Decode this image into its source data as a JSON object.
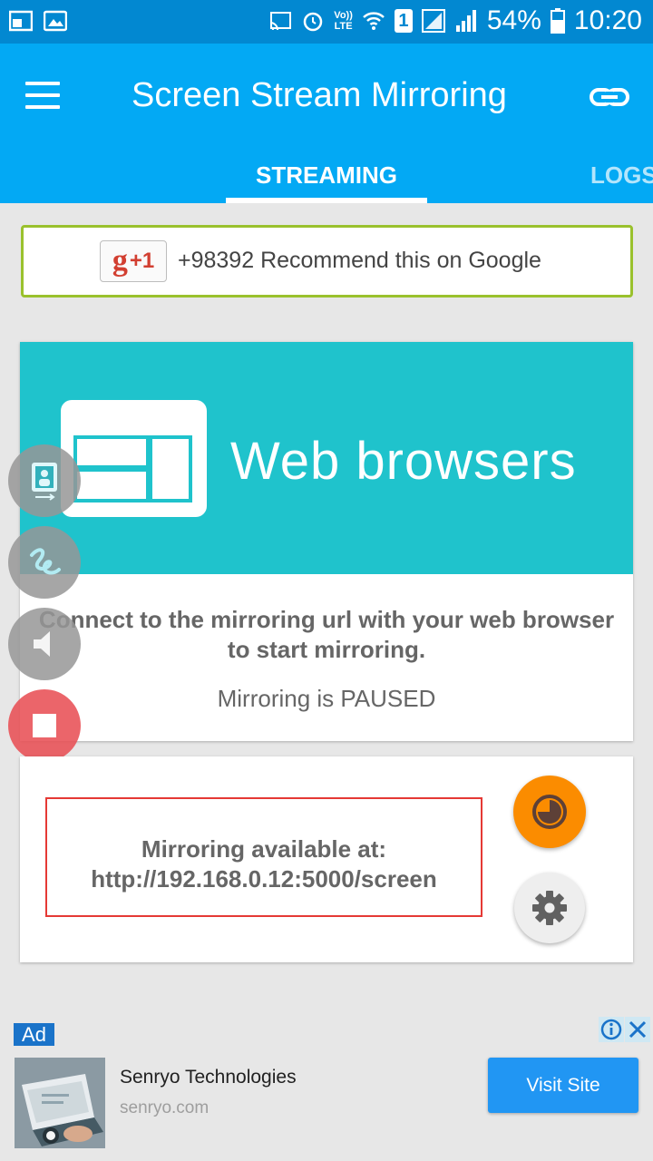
{
  "status_bar": {
    "battery": "54%",
    "time": "10:20",
    "lte_label": "LTE",
    "volte_label": "Vo))",
    "sim_slot": "1"
  },
  "app_bar": {
    "title": "Screen Stream Mirroring",
    "tabs": [
      {
        "label": "STREAMING",
        "active": true
      },
      {
        "label": "LOGS",
        "active": false
      }
    ]
  },
  "gplus": {
    "badge_g": "g",
    "badge_plus": "+1",
    "text": "+98392 Recommend this on Google"
  },
  "web_card": {
    "title": "Web browsers",
    "description_line1": "Connect to the mirroring url with your web browser",
    "description_line2": "to start mirroring.",
    "status": "Mirroring is PAUSED"
  },
  "mirror_card": {
    "label": "Mirroring available at:",
    "url": "http://192.168.0.12:5000/screen"
  },
  "ad": {
    "badge": "Ad",
    "advertiser": "Senryo Technologies",
    "domain": "senryo.com",
    "button_label": "Visit Site"
  },
  "colors": {
    "status_bar": "#0288d1",
    "app_bar": "#03a9f4",
    "card_header": "#1fc3cc",
    "fab_orange": "#fb8c00",
    "stop_button": "#e85055",
    "gplus_border": "#9ac12d",
    "url_box_border": "#e53935"
  },
  "icons": {
    "menu": "hamburger-icon",
    "link": "link-icon",
    "side_buttons": [
      "screen-share-icon",
      "draw-icon",
      "speaker-icon",
      "stop-icon"
    ],
    "fab_orange": "timer-icon",
    "fab_gear": "gear-icon"
  }
}
